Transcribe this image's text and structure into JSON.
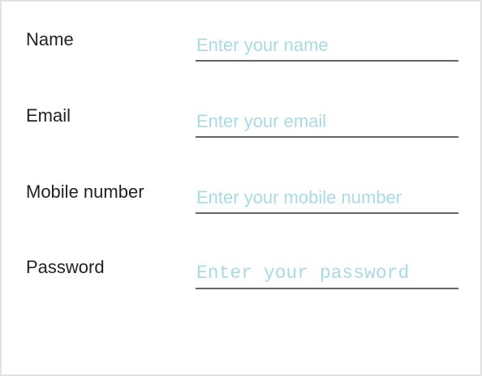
{
  "form": {
    "name": {
      "label": "Name",
      "placeholder": "Enter your name",
      "value": ""
    },
    "email": {
      "label": "Email",
      "placeholder": "Enter your email",
      "value": ""
    },
    "mobile": {
      "label": "Mobile number",
      "placeholder": "Enter your mobile number",
      "value": ""
    },
    "password": {
      "label": "Password",
      "placeholder": "Enter your password",
      "value": ""
    }
  },
  "colors": {
    "label_text": "#222222",
    "placeholder": "#a8dbe2",
    "underline": "#666666",
    "border": "#e2e2e2",
    "background": "#ffffff"
  }
}
